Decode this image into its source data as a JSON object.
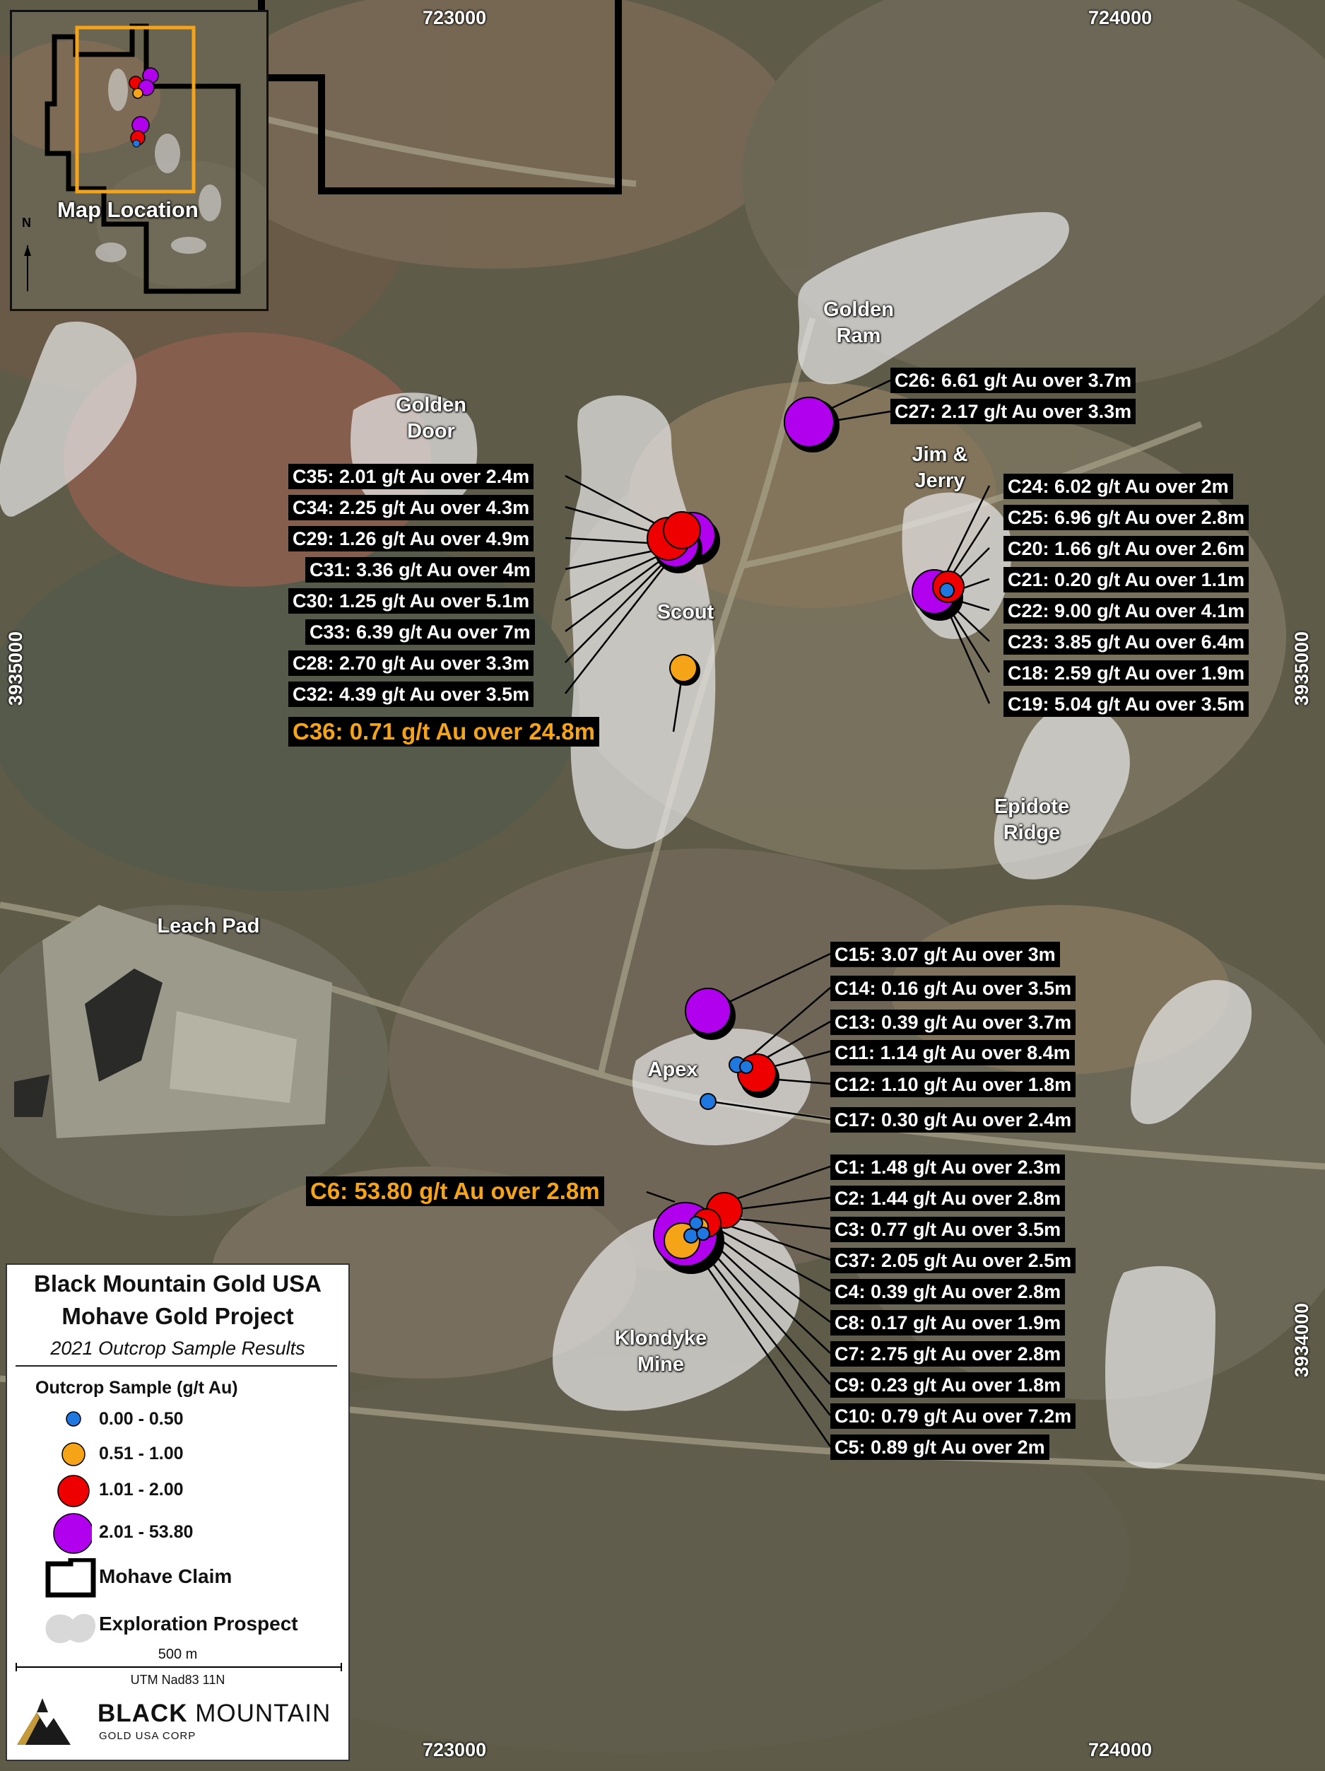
{
  "coordinates": {
    "easting_top": [
      "723000",
      "724000"
    ],
    "easting_bottom": [
      "723000",
      "724000"
    ],
    "northing_left": "3935000",
    "northing_right": [
      "3935000",
      "3934000"
    ]
  },
  "inset": {
    "label": "Map Location",
    "north": "N"
  },
  "place_names": [
    {
      "id": "golden-ram",
      "text": "Golden\nRam"
    },
    {
      "id": "golden-door",
      "text": "Golden\nDoor"
    },
    {
      "id": "jim-jerry",
      "text": "Jim &\nJerry"
    },
    {
      "id": "scout",
      "text": "Scout"
    },
    {
      "id": "epidote-ridge",
      "text": "Epidote\nRidge"
    },
    {
      "id": "leach-pad",
      "text": "Leach Pad"
    },
    {
      "id": "apex",
      "text": "Apex"
    },
    {
      "id": "klondyke-mine",
      "text": "Klondyke\nMine"
    }
  ],
  "sample_labels": [
    {
      "id": "C26",
      "text": "C26: 6.61 g/t Au over 3.7m"
    },
    {
      "id": "C27",
      "text": "C27: 2.17 g/t Au over 3.3m"
    },
    {
      "id": "C35",
      "text": "C35: 2.01 g/t Au over 2.4m"
    },
    {
      "id": "C34",
      "text": "C34: 2.25 g/t Au over 4.3m"
    },
    {
      "id": "C29",
      "text": "C29: 1.26 g/t Au over 4.9m"
    },
    {
      "id": "C31",
      "text": "C31: 3.36 g/t Au over 4m"
    },
    {
      "id": "C30",
      "text": "C30: 1.25 g/t Au over 5.1m"
    },
    {
      "id": "C33",
      "text": "C33: 6.39 g/t Au over 7m"
    },
    {
      "id": "C28",
      "text": "C28: 2.70 g/t Au over 3.3m"
    },
    {
      "id": "C32",
      "text": "C32: 4.39 g/t Au over 3.5m"
    },
    {
      "id": "C36",
      "text": "C36: 0.71 g/t Au over 24.8m"
    },
    {
      "id": "C24",
      "text": "C24: 6.02 g/t Au over 2m"
    },
    {
      "id": "C25",
      "text": "C25: 6.96 g/t Au over 2.8m"
    },
    {
      "id": "C20",
      "text": "C20: 1.66 g/t Au over 2.6m"
    },
    {
      "id": "C21",
      "text": "C21: 0.20 g/t Au over 1.1m"
    },
    {
      "id": "C22",
      "text": "C22: 9.00 g/t Au over 4.1m"
    },
    {
      "id": "C23",
      "text": "C23: 3.85 g/t Au over 6.4m"
    },
    {
      "id": "C18",
      "text": "C18: 2.59 g/t Au over 1.9m"
    },
    {
      "id": "C19",
      "text": "C19: 5.04 g/t Au over 3.5m"
    },
    {
      "id": "C15",
      "text": "C15: 3.07 g/t Au over 3m"
    },
    {
      "id": "C14",
      "text": "C14: 0.16 g/t Au over 3.5m"
    },
    {
      "id": "C13",
      "text": "C13: 0.39 g/t Au over 3.7m"
    },
    {
      "id": "C11",
      "text": "C11: 1.14 g/t Au over 8.4m"
    },
    {
      "id": "C12",
      "text": "C12: 1.10 g/t Au over 1.8m"
    },
    {
      "id": "C17",
      "text": "C17: 0.30 g/t Au over 2.4m"
    },
    {
      "id": "C6",
      "text": "C6: 53.80 g/t Au over 2.8m"
    },
    {
      "id": "C1",
      "text": "C1: 1.48 g/t Au over 2.3m"
    },
    {
      "id": "C2",
      "text": "C2: 1.44 g/t Au over 2.8m"
    },
    {
      "id": "C3",
      "text": "C3: 0.77 g/t Au over 3.5m"
    },
    {
      "id": "C37",
      "text": "C37: 2.05 g/t Au over 2.5m"
    },
    {
      "id": "C4",
      "text": "C4: 0.39 g/t Au over 2.8m"
    },
    {
      "id": "C8",
      "text": "C8: 0.17 g/t Au over 1.9m"
    },
    {
      "id": "C7",
      "text": "C7: 2.75 g/t Au over 2.8m"
    },
    {
      "id": "C9",
      "text": "C9: 0.23 g/t Au over 1.8m"
    },
    {
      "id": "C10",
      "text": "C10: 0.79 g/t Au over 7.2m"
    },
    {
      "id": "C5",
      "text": "C5: 0.89 g/t Au over 2m"
    }
  ],
  "legend": {
    "title1": "Black Mountain Gold USA",
    "title2": "Mohave Gold Project",
    "subtitle": "2021 Outcrop Sample Results",
    "section": "Outcrop Sample (g/t Au)",
    "classes": [
      {
        "range": "0.00 - 0.50",
        "color": "#1f78e0"
      },
      {
        "range": "0.51 - 1.00",
        "color": "#f5a317"
      },
      {
        "range": "1.01 - 2.00",
        "color": "#ee0000"
      },
      {
        "range": "2.01 - 53.80",
        "color": "#b000ee"
      }
    ],
    "claim": "Mohave Claim",
    "prospect": "Exploration Prospect",
    "scale": "500 m",
    "projection": "UTM Nad83 11N"
  },
  "logo": {
    "name1": "BLACK",
    "name2": "MOUNTAIN",
    "tag": "GOLD USA CORP"
  },
  "colors": {
    "highlight": "#f5a317",
    "prospect_fill": "#e6e6e6"
  }
}
